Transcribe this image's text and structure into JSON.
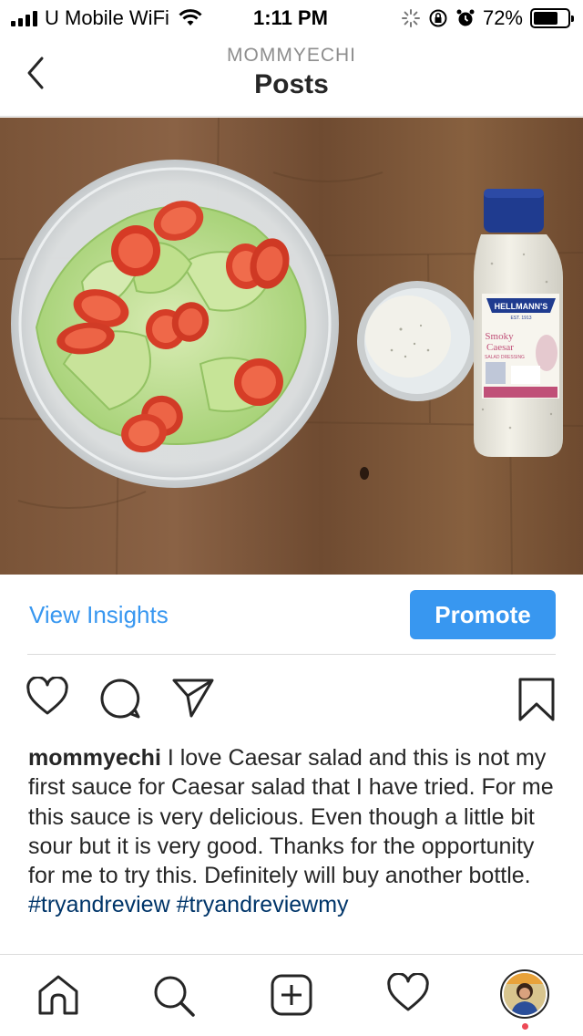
{
  "status_bar": {
    "carrier": "U Mobile WiFi",
    "time": "1:11 PM",
    "battery": "72%",
    "battery_level": 0.72
  },
  "header": {
    "username": "MOMMYECHI",
    "title": "Posts"
  },
  "photo": {
    "bottle_brand": "HELLMANN'S",
    "bottle_est": "EST. 1913",
    "bottle_name_line1": "Smoky",
    "bottle_name_line2": "Caesar",
    "bottle_sub": "SALAD DRESSING"
  },
  "insights": {
    "view_label": "View Insights",
    "promote_label": "Promote"
  },
  "caption": {
    "username": "mommyechi",
    "text": " I love Caesar salad and this is not my first sauce for Caesar salad that I have tried. For me this sauce is very delicious. Even though a little bit sour but it is very good. Thanks for the opportunity for me to try this. Definitely will buy another bottle. ",
    "tag1": "#tryandreview",
    "tag2": "#tryandreviewmy"
  },
  "colors": {
    "accent": "#3897f0",
    "hashtag": "#003569",
    "notification": "#ed4956"
  }
}
